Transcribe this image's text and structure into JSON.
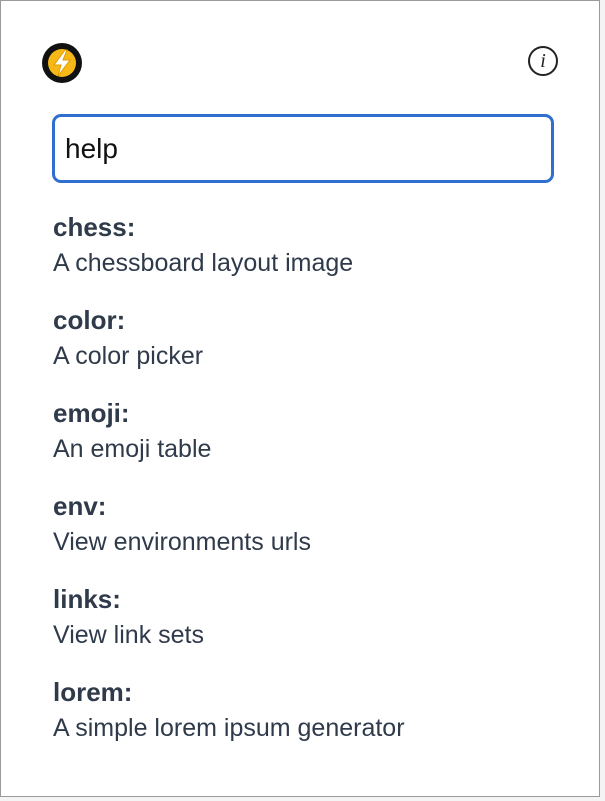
{
  "header": {
    "logo_icon": "lightning-bolt-icon",
    "info_icon": "info-icon",
    "info_glyph": "i",
    "logo_color": "#f6b817"
  },
  "search": {
    "value": "help",
    "border_color": "#2f6fd0"
  },
  "commands": [
    {
      "name": "chess:",
      "description": "A chessboard layout image"
    },
    {
      "name": "color:",
      "description": "A color picker"
    },
    {
      "name": "emoji:",
      "description": "An emoji table"
    },
    {
      "name": "env:",
      "description": "View environments urls"
    },
    {
      "name": "links:",
      "description": "View link sets"
    },
    {
      "name": "lorem:",
      "description": "A simple lorem ipsum generator"
    }
  ]
}
